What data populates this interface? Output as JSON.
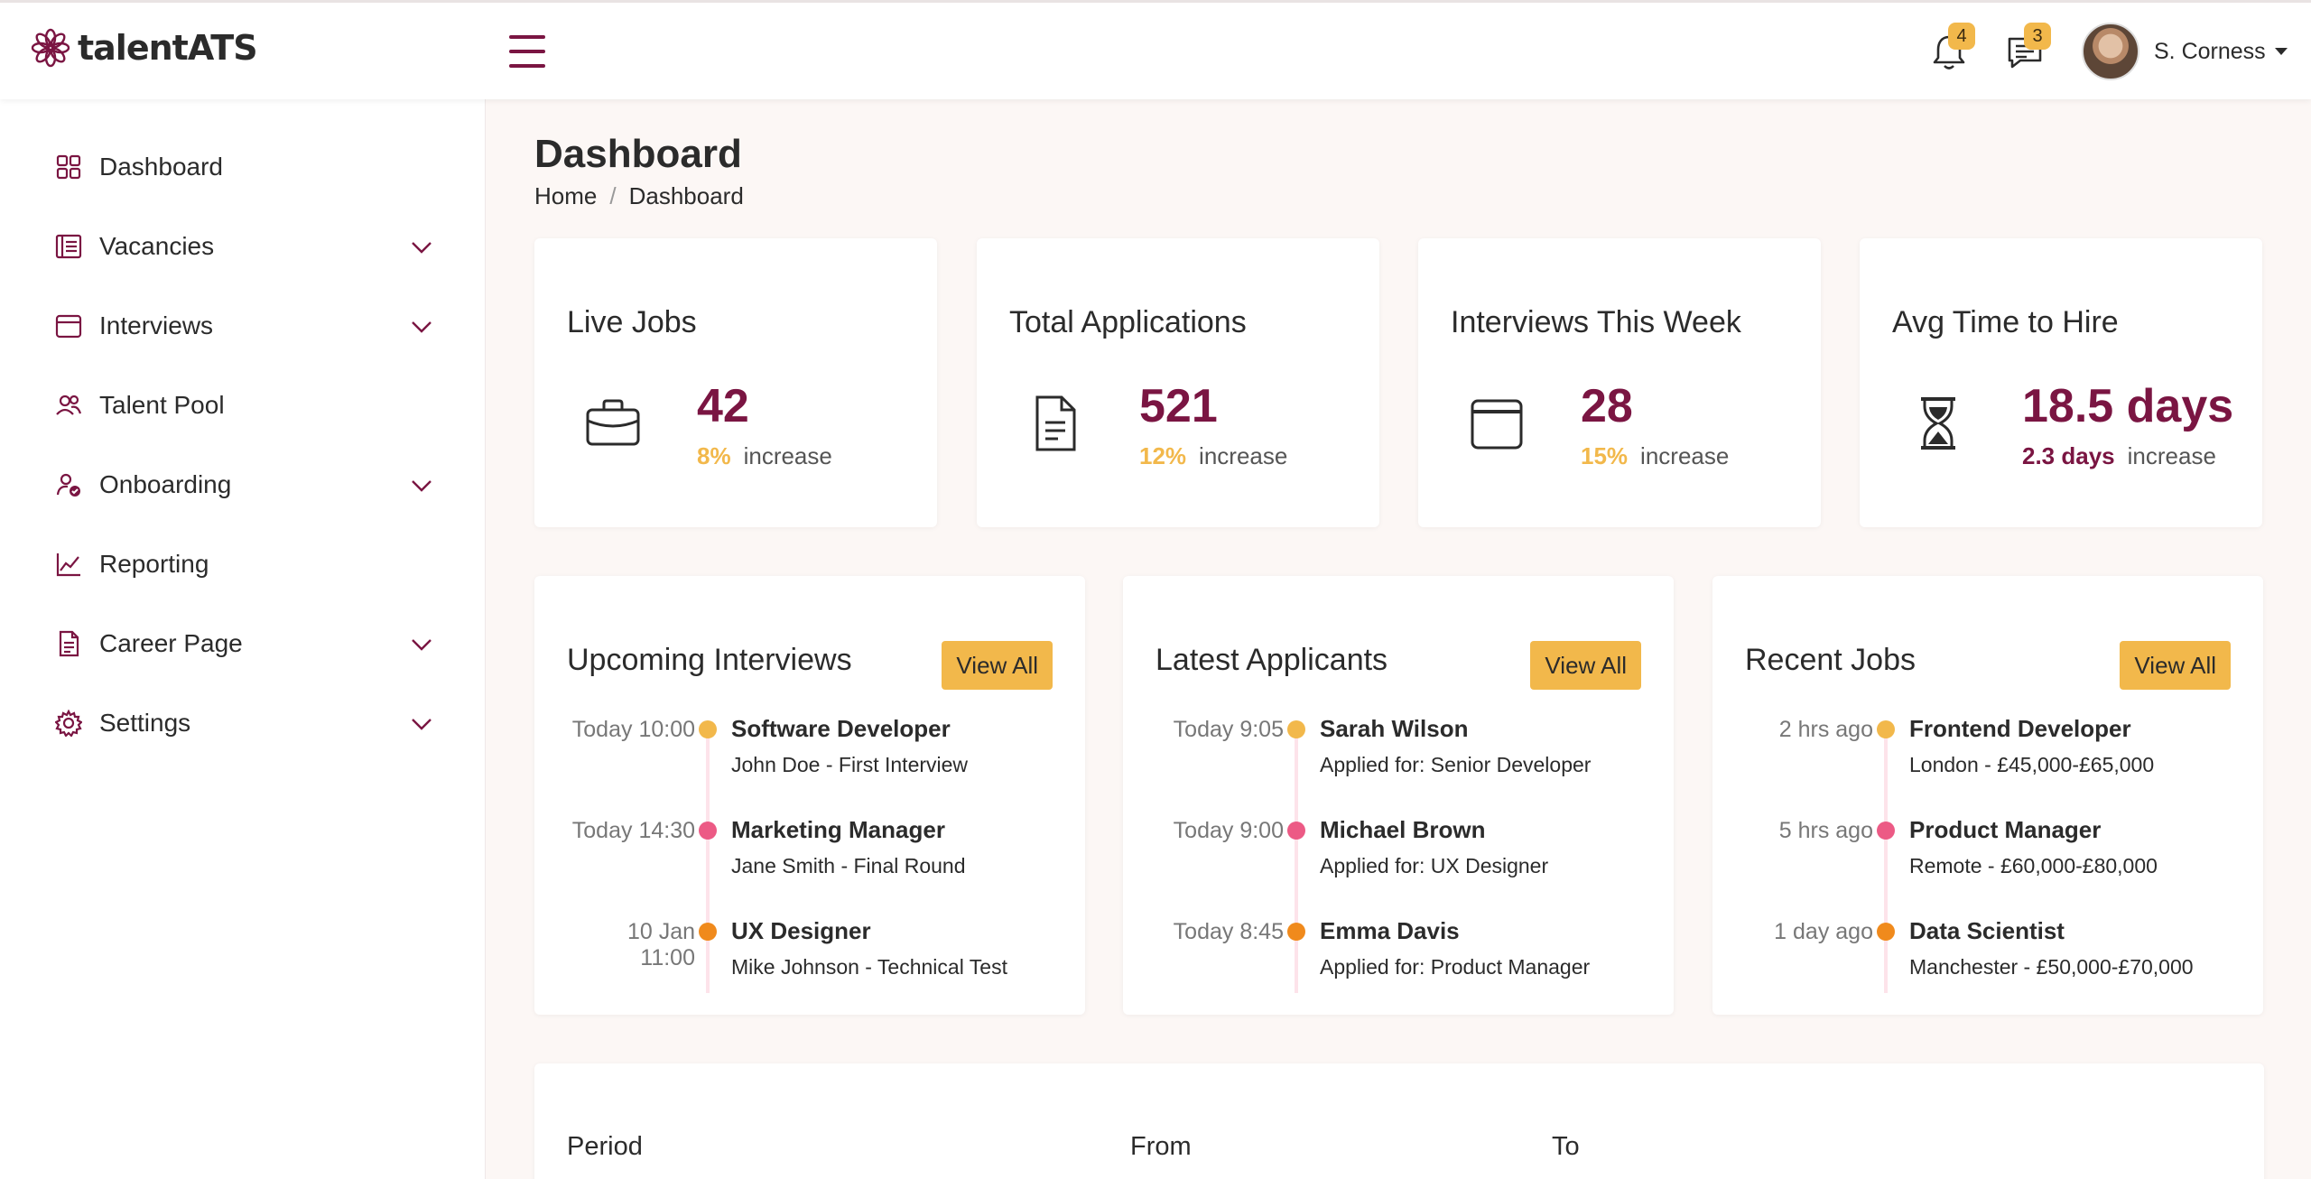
{
  "header": {
    "logo_text": "talentATS",
    "notifications_count": "4",
    "messages_count": "3",
    "user_name": "S. Corness"
  },
  "colors": {
    "brand": "#7a1542",
    "accent": "#f2b84b",
    "dot_pink": "#ec5a85",
    "dot_orange": "#f08a1c"
  },
  "sidebar": {
    "items": [
      {
        "label": "Dashboard",
        "icon": "grid-icon",
        "expandable": false
      },
      {
        "label": "Vacancies",
        "icon": "list-icon",
        "expandable": true
      },
      {
        "label": "Interviews",
        "icon": "calendar-icon",
        "expandable": true
      },
      {
        "label": "Talent Pool",
        "icon": "people-icon",
        "expandable": false
      },
      {
        "label": "Onboarding",
        "icon": "user-check-icon",
        "expandable": true
      },
      {
        "label": "Reporting",
        "icon": "line-chart-icon",
        "expandable": false
      },
      {
        "label": "Career Page",
        "icon": "document-icon",
        "expandable": true
      },
      {
        "label": "Settings",
        "icon": "gear-icon",
        "expandable": true
      }
    ]
  },
  "page": {
    "title": "Dashboard",
    "breadcrumb": [
      "Home",
      "Dashboard"
    ]
  },
  "stats": [
    {
      "title": "Live Jobs",
      "value": "42",
      "change": "8%",
      "change_word": "increase",
      "icon": "briefcase-icon"
    },
    {
      "title": "Total Applications",
      "value": "521",
      "change": "12%",
      "change_word": "increase",
      "icon": "document-icon"
    },
    {
      "title": "Interviews This Week",
      "value": "28",
      "change": "15%",
      "change_word": "increase",
      "icon": "calendar-icon"
    },
    {
      "title": "Avg Time to Hire",
      "value": "18.5 days",
      "change": "2.3 days",
      "change_word": "increase",
      "icon": "hourglass-icon"
    }
  ],
  "panels": [
    {
      "title": "Upcoming Interviews",
      "button": "View All",
      "items": [
        {
          "time": "Today 10:00",
          "main": "Software Developer",
          "sub": "John Doe - First Interview"
        },
        {
          "time": "Today 14:30",
          "main": "Marketing Manager",
          "sub": "Jane Smith - Final Round"
        },
        {
          "time": "10 Jan 11:00",
          "main": "UX Designer",
          "sub": "Mike Johnson - Technical Test"
        }
      ]
    },
    {
      "title": "Latest Applicants",
      "button": "View All",
      "items": [
        {
          "time": "Today 9:05",
          "main": "Sarah Wilson",
          "sub": "Applied for: Senior Developer"
        },
        {
          "time": "Today 9:00",
          "main": "Michael Brown",
          "sub": "Applied for: UX Designer"
        },
        {
          "time": "Today 8:45",
          "main": "Emma Davis",
          "sub": "Applied for: Product Manager"
        }
      ]
    },
    {
      "title": "Recent Jobs",
      "button": "View All",
      "items": [
        {
          "time": "2 hrs ago",
          "main": "Frontend Developer",
          "sub": "London - £45,000-£65,000"
        },
        {
          "time": "5 hrs ago",
          "main": "Product Manager",
          "sub": "Remote - £60,000-£80,000"
        },
        {
          "time": "1 day ago",
          "main": "Data Scientist",
          "sub": "Manchester - £50,000-£70,000"
        }
      ]
    }
  ],
  "filter": {
    "period_label": "Period",
    "from_label": "From",
    "to_label": "To"
  }
}
